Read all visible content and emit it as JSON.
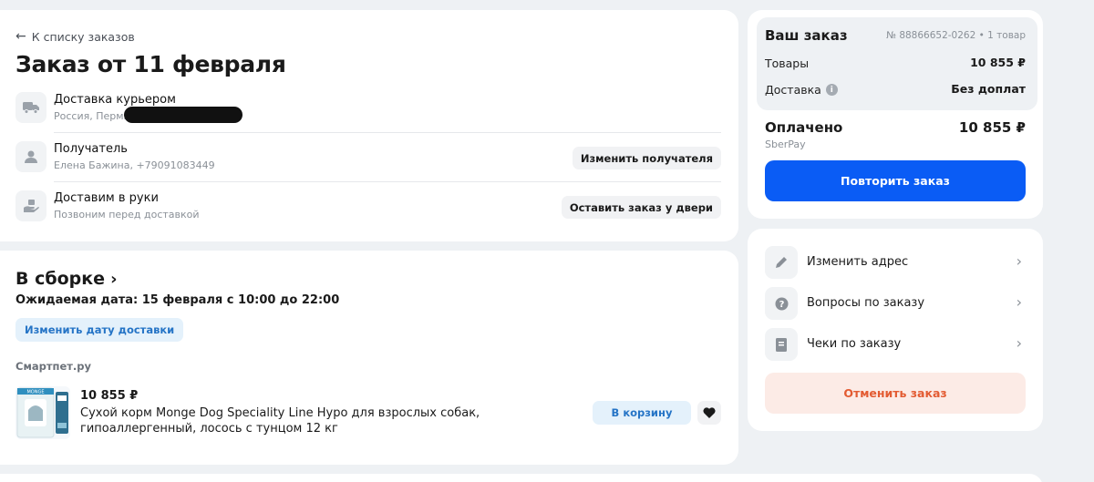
{
  "header": {
    "back_label": "К списку заказов",
    "title": "Заказ от 11 февраля"
  },
  "delivery": {
    "title": "Доставка курьером",
    "subtitle": "Россия, Пермь"
  },
  "recipient": {
    "title": "Получатель",
    "subtitle": "Елена Бажина, +79091083449",
    "button": "Изменить получателя"
  },
  "handover": {
    "title": "Доставим в руки",
    "subtitle": "Позвоним перед доставкой",
    "button": "Оставить заказ у двери"
  },
  "assembly": {
    "status": "В сборке",
    "expected": "Ожидаемая дата: 15 февраля с 10:00 до 22:00",
    "change_date_button": "Изменить дату доставки",
    "seller": "Смартпет.ру"
  },
  "product": {
    "price": "10 855 ₽",
    "name": "Сухой корм Monge Dog Speciality Line Hypo для взрослых собак, гипоаллергенный, лосось с тунцом 12 кг",
    "to_cart_button": "В корзину",
    "image_brand": "MONGE"
  },
  "summary": {
    "title": "Ваш заказ",
    "order_number": "№ 88866652-0262 • 1 товар",
    "goods_label": "Товары",
    "goods_value": "10 855 ₽",
    "delivery_label": "Доставка",
    "delivery_value": "Без доплат",
    "paid_label": "Оплачено",
    "paid_value": "10 855 ₽",
    "payment_method": "SberPay",
    "repeat_button": "Повторить заказ"
  },
  "actions": {
    "items": [
      {
        "label": "Изменить адрес",
        "icon": "pencil-icon"
      },
      {
        "label": "Вопросы по заказу",
        "icon": "question-icon"
      },
      {
        "label": "Чеки по заказу",
        "icon": "receipt-icon"
      }
    ],
    "cancel_button": "Отменить заказ"
  },
  "colors": {
    "primary": "#0a5cf5",
    "danger": "#e35b32",
    "link": "#2574c6",
    "background": "#eef1f4"
  }
}
